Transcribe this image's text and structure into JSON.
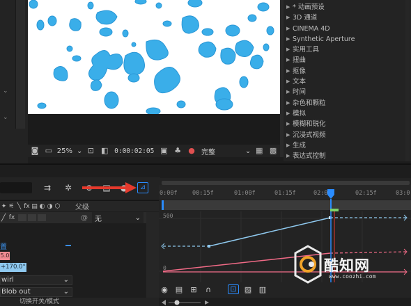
{
  "viewer": {
    "zoom": "25%",
    "timecode": "0:00:02:05",
    "quality": "完整"
  },
  "effects_panel": {
    "items": [
      "* 动画预设",
      "3D 通道",
      "CINEMA 4D",
      "Synthetic Aperture",
      "实用工具",
      "扭曲",
      "抠像",
      "文本",
      "时间",
      "杂色和颗粒",
      "模拟",
      "模糊和锐化",
      "沉浸式视频",
      "生成",
      "表达式控制"
    ]
  },
  "timeline": {
    "ruler_labels": [
      "0:00f",
      "00:15f",
      "01:00f",
      "01:15f",
      "02:00f",
      "02:15f",
      "03:0"
    ],
    "parent_header": "父级",
    "parent_value": "无",
    "graph_value_500": "500",
    "graph_value_0": "0",
    "pink_value": "5.0",
    "blue_value": "+170.0°",
    "select_1": "wirl",
    "select_2": "Blob out",
    "property_label": "置",
    "switch_mode_label": "切换开关/模式"
  },
  "watermark": {
    "name": "酷知网",
    "url": "www.coozhi.com"
  },
  "colors": {
    "accent_blue": "#2a8cff",
    "blob_blue": "#3aaee9",
    "curve_pink": "#f06a86",
    "curve_blue": "#8fc9ef",
    "arrow_red": "#e5392c"
  }
}
